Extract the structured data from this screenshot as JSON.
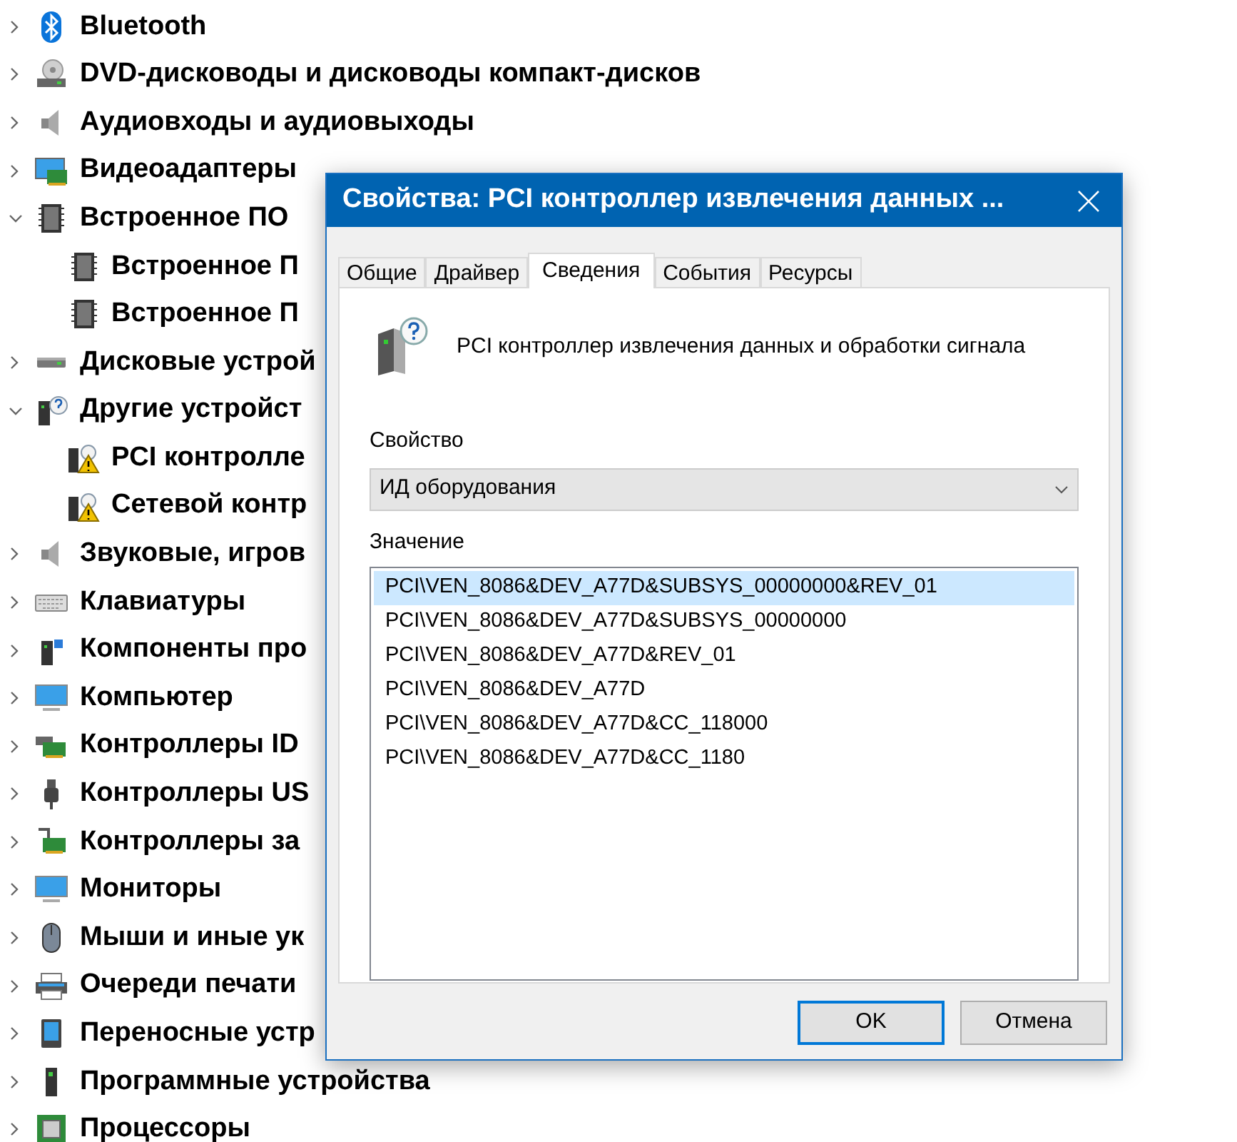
{
  "tree": [
    {
      "label": "Bluetooth",
      "expanded": false
    },
    {
      "label": "DVD-дисководы и дисководы компакт-дисков",
      "expanded": false
    },
    {
      "label": "Аудиовходы и аудиовыходы",
      "expanded": false
    },
    {
      "label": "Видеоадаптеры",
      "expanded": false
    },
    {
      "label": "Встроенное ПО",
      "expanded": true,
      "children": [
        {
          "label": "Встроенное П"
        },
        {
          "label": "Встроенное П"
        }
      ]
    },
    {
      "label": "Дисковые устрой",
      "expanded": false
    },
    {
      "label": "Другие устройст",
      "expanded": true,
      "children": [
        {
          "label": "PCI контролле"
        },
        {
          "label": "Сетевой контр"
        }
      ]
    },
    {
      "label": "Звуковые, игров",
      "expanded": false
    },
    {
      "label": "Клавиатуры",
      "expanded": false
    },
    {
      "label": "Компоненты про",
      "expanded": false
    },
    {
      "label": "Компьютер",
      "expanded": false
    },
    {
      "label": "Контроллеры ID",
      "expanded": false
    },
    {
      "label": "Контроллеры US",
      "expanded": false
    },
    {
      "label": "Контроллеры за",
      "expanded": false
    },
    {
      "label": "Мониторы",
      "expanded": false
    },
    {
      "label": "Мыши и иные ук",
      "expanded": false
    },
    {
      "label": "Очереди печати",
      "expanded": false
    },
    {
      "label": "Переносные устр",
      "expanded": false
    },
    {
      "label": "Программные устройства",
      "expanded": false
    },
    {
      "label": "Процессоры",
      "expanded": false
    }
  ],
  "dialog": {
    "title": "Свойства: PCI контроллер извлечения данных ...",
    "tabs": [
      {
        "label": "Общие",
        "selected": false
      },
      {
        "label": "Драйвер",
        "selected": false
      },
      {
        "label": "Сведения",
        "selected": true
      },
      {
        "label": "События",
        "selected": false
      },
      {
        "label": "Ресурсы",
        "selected": false
      }
    ],
    "device_name": "PCI контроллер извлечения данных и обработки сигнала",
    "property_label": "Свойство",
    "property_value": "ИД оборудования",
    "value_label": "Значение",
    "values": [
      {
        "text": "PCI\\VEN_8086&DEV_A77D&SUBSYS_00000000&REV_01",
        "selected": true
      },
      {
        "text": "PCI\\VEN_8086&DEV_A77D&SUBSYS_00000000",
        "selected": false
      },
      {
        "text": "PCI\\VEN_8086&DEV_A77D&REV_01",
        "selected": false
      },
      {
        "text": "PCI\\VEN_8086&DEV_A77D",
        "selected": false
      },
      {
        "text": "PCI\\VEN_8086&DEV_A77D&CC_118000",
        "selected": false
      },
      {
        "text": "PCI\\VEN_8086&DEV_A77D&CC_1180",
        "selected": false
      }
    ],
    "buttons": [
      {
        "label": "OK",
        "default": true
      },
      {
        "label": "Отмена",
        "default": false
      }
    ]
  }
}
